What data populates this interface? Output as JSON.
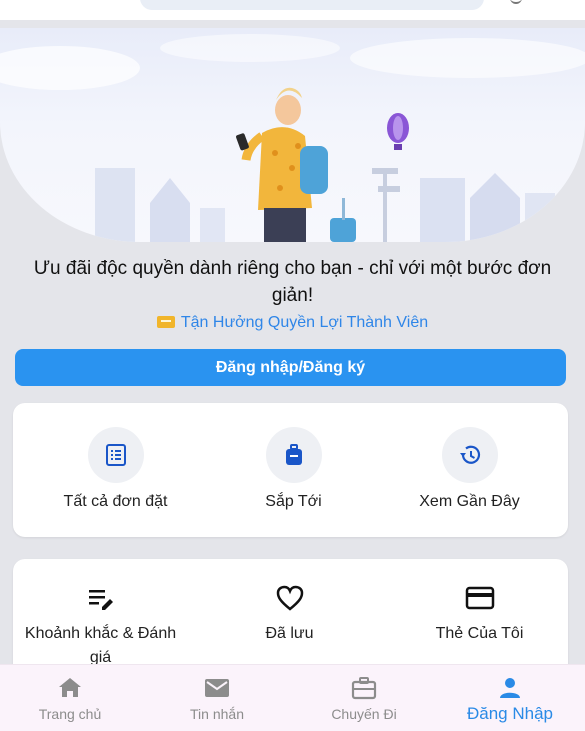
{
  "promo": {
    "title": "Ưu đãi độc quyền dành riêng cho bạn - chỉ với một bước đơn giản!",
    "member_link": "Tận Hưởng Quyền Lợi Thành Viên"
  },
  "login_button": "Đăng nhập/Đăng ký",
  "orders": {
    "items": [
      {
        "label": "Tất cả đơn đặt",
        "icon": "list-icon"
      },
      {
        "label": "Sắp Tới",
        "icon": "suitcase-icon"
      },
      {
        "label": "Xem Gần Đây",
        "icon": "history-icon"
      }
    ]
  },
  "tools": {
    "items": [
      {
        "label": "Khoảnh khắc & Đánh giá",
        "icon": "edit-note-icon"
      },
      {
        "label": "Đã lưu",
        "icon": "heart-icon"
      },
      {
        "label": "Thẻ Của Tôi",
        "icon": "credit-card-icon"
      }
    ]
  },
  "bottom_nav": {
    "items": [
      {
        "label": "Trang chủ",
        "icon": "home-icon",
        "active": false
      },
      {
        "label": "Tin nhắn",
        "icon": "mail-icon",
        "active": false
      },
      {
        "label": "Chuyến Đi",
        "icon": "briefcase-icon",
        "active": false
      },
      {
        "label": "Đăng Nhập",
        "icon": "person-icon",
        "active": true
      }
    ]
  },
  "colors": {
    "accent": "#2a93f0",
    "icon_blue": "#1a56c8",
    "background": "#e4e5ea",
    "nav_bg": "#fbf3fb"
  }
}
